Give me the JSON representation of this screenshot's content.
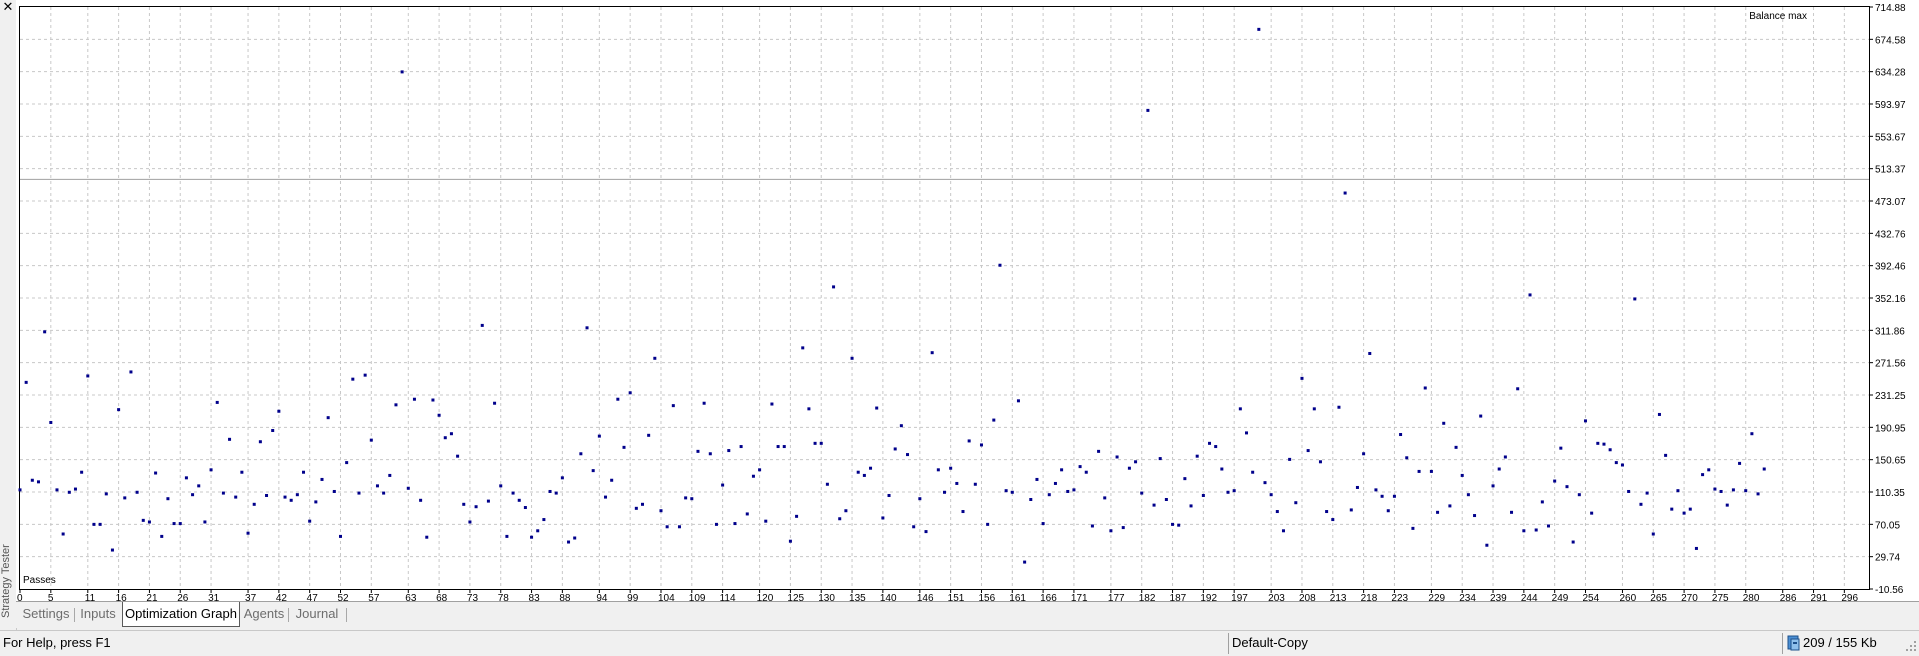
{
  "window": {
    "close_icon": "close-icon",
    "side_label": "Strategy Tester"
  },
  "chart_data": {
    "type": "scatter",
    "title": "Balance max",
    "xlabel": "Passes",
    "ylabel": "",
    "y_ticks": [
      "714.88",
      "674.58",
      "634.28",
      "593.97",
      "553.67",
      "513.37",
      "473.07",
      "432.76",
      "392.46",
      "352.16",
      "311.86",
      "271.56",
      "231.25",
      "190.95",
      "150.65",
      "110.35",
      "70.05",
      "29.74",
      "-10.56"
    ],
    "x_ticks": [
      "0",
      "5",
      "11",
      "16",
      "21",
      "26",
      "31",
      "37",
      "42",
      "47",
      "52",
      "57",
      "63",
      "68",
      "73",
      "78",
      "83",
      "88",
      "94",
      "99",
      "104",
      "109",
      "114",
      "120",
      "125",
      "130",
      "135",
      "140",
      "146",
      "151",
      "156",
      "161",
      "166",
      "171",
      "177",
      "182",
      "187",
      "192",
      "197",
      "203",
      "208",
      "213",
      "218",
      "223",
      "229",
      "234",
      "239",
      "244",
      "249",
      "254",
      "260",
      "265",
      "270",
      "275",
      "280",
      "286",
      "291",
      "296"
    ],
    "ylim": [
      -10.56,
      714.88
    ],
    "xlim": [
      0,
      300
    ],
    "grid": true,
    "reference_line": 500,
    "series": [
      {
        "color": "#00008b",
        "points": [
          [
            0,
            113
          ],
          [
            1,
            247
          ],
          [
            2,
            125
          ],
          [
            3,
            123
          ],
          [
            4,
            310
          ],
          [
            5,
            197
          ],
          [
            6,
            113
          ],
          [
            7,
            58
          ],
          [
            8,
            110
          ],
          [
            9,
            114
          ],
          [
            10,
            135
          ],
          [
            11,
            255
          ],
          [
            12,
            70
          ],
          [
            13,
            70
          ],
          [
            14,
            108
          ],
          [
            15,
            38
          ],
          [
            16,
            213
          ],
          [
            17,
            103
          ],
          [
            18,
            260
          ],
          [
            19,
            110
          ],
          [
            20,
            75
          ],
          [
            21,
            73
          ],
          [
            22,
            134
          ],
          [
            23,
            55
          ],
          [
            24,
            102
          ],
          [
            25,
            71
          ],
          [
            26,
            71
          ],
          [
            27,
            128
          ],
          [
            28,
            107
          ],
          [
            29,
            118
          ],
          [
            30,
            73
          ],
          [
            31,
            138
          ],
          [
            32,
            222
          ],
          [
            33,
            109
          ],
          [
            34,
            176
          ],
          [
            35,
            104
          ],
          [
            36,
            135
          ],
          [
            37,
            59
          ],
          [
            38,
            95
          ],
          [
            39,
            173
          ],
          [
            40,
            106
          ],
          [
            41,
            187
          ],
          [
            42,
            211
          ],
          [
            43,
            104
          ],
          [
            44,
            100
          ],
          [
            45,
            107
          ],
          [
            46,
            135
          ],
          [
            47,
            74
          ],
          [
            48,
            98
          ],
          [
            49,
            126
          ],
          [
            50,
            203
          ],
          [
            51,
            111
          ],
          [
            52,
            55
          ],
          [
            53,
            147
          ],
          [
            54,
            251
          ],
          [
            55,
            109
          ],
          [
            56,
            256
          ],
          [
            57,
            175
          ],
          [
            58,
            118
          ],
          [
            59,
            109
          ],
          [
            60,
            131
          ],
          [
            61,
            219
          ],
          [
            62,
            634
          ],
          [
            63,
            115
          ],
          [
            64,
            226
          ],
          [
            65,
            100
          ],
          [
            66,
            54
          ],
          [
            67,
            225
          ],
          [
            68,
            206
          ],
          [
            69,
            178
          ],
          [
            70,
            183
          ],
          [
            71,
            155
          ],
          [
            72,
            95
          ],
          [
            73,
            73
          ],
          [
            74,
            92
          ],
          [
            75,
            318
          ],
          [
            76,
            99
          ],
          [
            77,
            221
          ],
          [
            78,
            118
          ],
          [
            79,
            55
          ],
          [
            80,
            109
          ],
          [
            81,
            100
          ],
          [
            82,
            91
          ],
          [
            83,
            54
          ],
          [
            84,
            62
          ],
          [
            85,
            76
          ],
          [
            86,
            111
          ],
          [
            87,
            109
          ],
          [
            88,
            128
          ],
          [
            89,
            48
          ],
          [
            90,
            53
          ],
          [
            91,
            158
          ],
          [
            92,
            315
          ],
          [
            93,
            137
          ],
          [
            94,
            180
          ],
          [
            95,
            104
          ],
          [
            96,
            125
          ],
          [
            97,
            226
          ],
          [
            98,
            166
          ],
          [
            99,
            234
          ],
          [
            100,
            90
          ],
          [
            101,
            95
          ],
          [
            102,
            181
          ],
          [
            103,
            277
          ],
          [
            104,
            87
          ],
          [
            105,
            67
          ],
          [
            106,
            218
          ],
          [
            107,
            67
          ],
          [
            108,
            103
          ],
          [
            109,
            102
          ],
          [
            110,
            161
          ],
          [
            111,
            221
          ],
          [
            112,
            158
          ],
          [
            113,
            70
          ],
          [
            114,
            119
          ],
          [
            115,
            162
          ],
          [
            116,
            71
          ],
          [
            117,
            167
          ],
          [
            118,
            83
          ],
          [
            119,
            130
          ],
          [
            120,
            138
          ],
          [
            121,
            74
          ],
          [
            122,
            220
          ],
          [
            123,
            167
          ],
          [
            124,
            167
          ],
          [
            125,
            49
          ],
          [
            126,
            80
          ],
          [
            127,
            290
          ],
          [
            128,
            214
          ],
          [
            129,
            171
          ],
          [
            130,
            171
          ],
          [
            131,
            120
          ],
          [
            132,
            366
          ],
          [
            133,
            77
          ],
          [
            134,
            87
          ],
          [
            135,
            277
          ],
          [
            136,
            135
          ],
          [
            137,
            131
          ],
          [
            138,
            140
          ],
          [
            139,
            215
          ],
          [
            140,
            78
          ],
          [
            141,
            106
          ],
          [
            142,
            164
          ],
          [
            143,
            193
          ],
          [
            144,
            157
          ],
          [
            145,
            67
          ],
          [
            146,
            102
          ],
          [
            147,
            61
          ],
          [
            148,
            284
          ],
          [
            149,
            138
          ],
          [
            150,
            110
          ],
          [
            151,
            140
          ],
          [
            152,
            121
          ],
          [
            153,
            86
          ],
          [
            154,
            174
          ],
          [
            155,
            120
          ],
          [
            156,
            169
          ],
          [
            157,
            70
          ],
          [
            158,
            200
          ],
          [
            159,
            393
          ],
          [
            160,
            112
          ],
          [
            161,
            110
          ],
          [
            162,
            224
          ],
          [
            163,
            23
          ],
          [
            164,
            101
          ],
          [
            165,
            126
          ],
          [
            166,
            71
          ],
          [
            167,
            107
          ],
          [
            168,
            121
          ],
          [
            169,
            138
          ],
          [
            170,
            111
          ],
          [
            171,
            113
          ],
          [
            172,
            142
          ],
          [
            173,
            135
          ],
          [
            174,
            68
          ],
          [
            175,
            161
          ],
          [
            176,
            103
          ],
          [
            177,
            62
          ],
          [
            178,
            154
          ],
          [
            179,
            66
          ],
          [
            180,
            140
          ],
          [
            181,
            148
          ],
          [
            182,
            109
          ],
          [
            183,
            586
          ],
          [
            184,
            94
          ],
          [
            185,
            152
          ],
          [
            186,
            101
          ],
          [
            187,
            70
          ],
          [
            188,
            69
          ],
          [
            189,
            127
          ],
          [
            190,
            93
          ],
          [
            191,
            155
          ],
          [
            192,
            106
          ],
          [
            193,
            171
          ],
          [
            194,
            167
          ],
          [
            195,
            139
          ],
          [
            196,
            110
          ],
          [
            197,
            112
          ],
          [
            198,
            214
          ],
          [
            199,
            184
          ],
          [
            200,
            135
          ],
          [
            201,
            687
          ],
          [
            202,
            122
          ],
          [
            203,
            107
          ],
          [
            204,
            86
          ],
          [
            205,
            62
          ],
          [
            206,
            151
          ],
          [
            207,
            97
          ],
          [
            208,
            252
          ],
          [
            209,
            162
          ],
          [
            210,
            214
          ],
          [
            211,
            148
          ],
          [
            212,
            86
          ],
          [
            213,
            76
          ],
          [
            214,
            216
          ],
          [
            215,
            483
          ],
          [
            216,
            88
          ],
          [
            217,
            116
          ],
          [
            218,
            158
          ],
          [
            219,
            283
          ],
          [
            220,
            113
          ],
          [
            221,
            105
          ],
          [
            222,
            87
          ],
          [
            223,
            105
          ],
          [
            224,
            182
          ],
          [
            225,
            153
          ],
          [
            226,
            65
          ],
          [
            227,
            136
          ],
          [
            228,
            240
          ],
          [
            229,
            136
          ],
          [
            230,
            85
          ],
          [
            231,
            196
          ],
          [
            232,
            93
          ],
          [
            233,
            166
          ],
          [
            234,
            131
          ],
          [
            235,
            107
          ],
          [
            236,
            81
          ],
          [
            237,
            205
          ],
          [
            238,
            44
          ],
          [
            239,
            118
          ],
          [
            240,
            139
          ],
          [
            241,
            154
          ],
          [
            242,
            85
          ],
          [
            243,
            239
          ],
          [
            244,
            62
          ],
          [
            245,
            356
          ],
          [
            246,
            63
          ],
          [
            247,
            98
          ],
          [
            248,
            68
          ],
          [
            249,
            124
          ],
          [
            250,
            165
          ],
          [
            251,
            117
          ],
          [
            252,
            48
          ],
          [
            253,
            107
          ],
          [
            254,
            199
          ],
          [
            255,
            84
          ],
          [
            256,
            171
          ],
          [
            257,
            170
          ],
          [
            258,
            163
          ],
          [
            259,
            147
          ],
          [
            260,
            144
          ],
          [
            261,
            111
          ],
          [
            262,
            351
          ],
          [
            263,
            95
          ],
          [
            264,
            109
          ],
          [
            265,
            58
          ],
          [
            266,
            207
          ],
          [
            267,
            156
          ],
          [
            268,
            89
          ],
          [
            269,
            112
          ],
          [
            270,
            84
          ],
          [
            271,
            89
          ],
          [
            272,
            40
          ],
          [
            273,
            132
          ],
          [
            274,
            138
          ],
          [
            275,
            114
          ],
          [
            276,
            111
          ],
          [
            277,
            94
          ],
          [
            278,
            113
          ],
          [
            279,
            146
          ],
          [
            280,
            112
          ],
          [
            281,
            183
          ],
          [
            282,
            108
          ],
          [
            283,
            139
          ]
        ]
      }
    ]
  },
  "tabs": [
    {
      "label": "Settings",
      "active": false
    },
    {
      "label": "Inputs",
      "active": false
    },
    {
      "label": "Optimization Graph",
      "active": true
    },
    {
      "label": "Agents",
      "active": false
    },
    {
      "label": "Journal",
      "active": false
    }
  ],
  "status": {
    "help": "For Help, press F1",
    "profile": "Default-Copy",
    "traffic": "209 / 155 Kb",
    "traffic_icon": "network-traffic-icon",
    "grip_icon": "resize-grip-icon"
  }
}
